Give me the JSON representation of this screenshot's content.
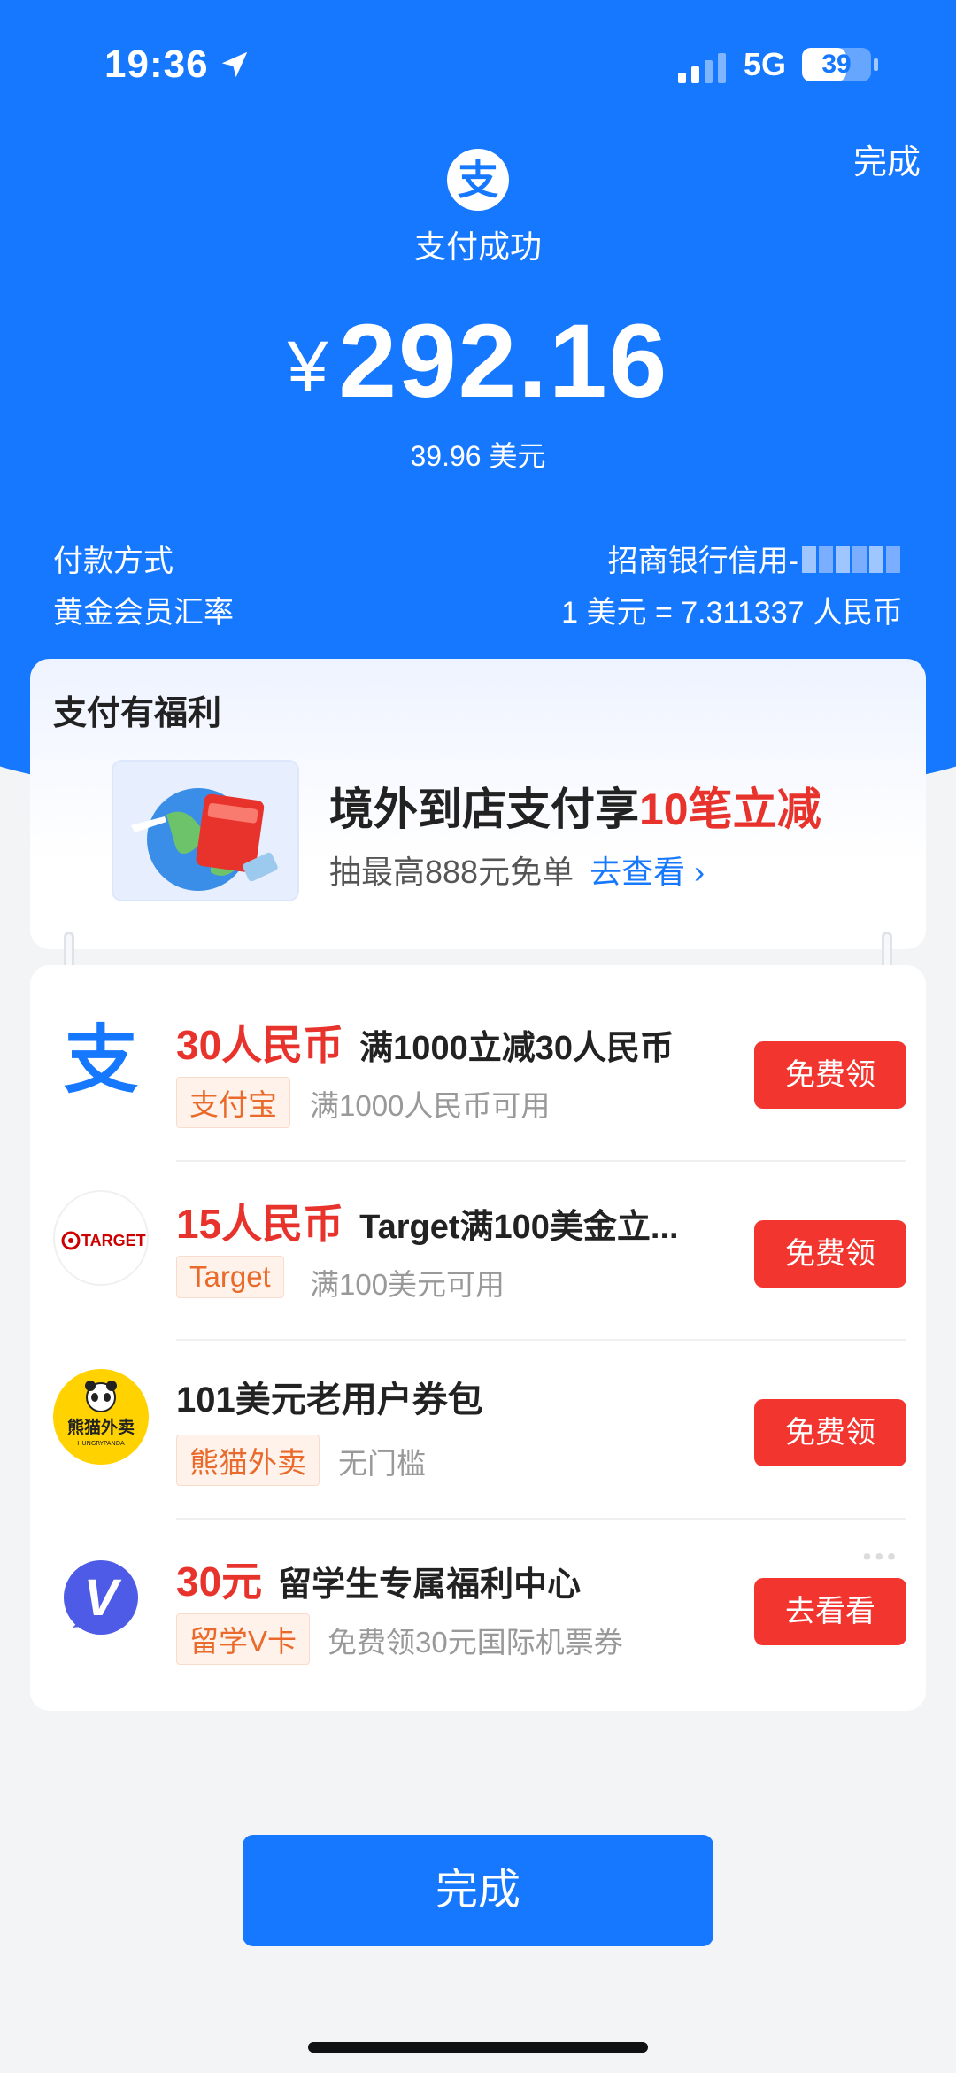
{
  "status_bar": {
    "time": "19:36",
    "network": "5G",
    "battery": "39"
  },
  "header": {
    "done_label": "完成",
    "success_text": "支付成功",
    "currency_symbol": "¥",
    "amount": "292.16",
    "original_amount": "39.96 美元",
    "app_logo_char": "支"
  },
  "details": [
    {
      "label": "付款方式",
      "value": "招商银行信用-"
    },
    {
      "label": "黄金会员汇率",
      "value": "1 美元 = 7.311337 人民币"
    }
  ],
  "benefits": {
    "title": "支付有福利",
    "promo_title_main": "境外到店支付享",
    "promo_title_highlight": "10笔立减",
    "promo_sub": "抽最高888元免单",
    "promo_link": "去查看 ›"
  },
  "coupons": [
    {
      "logo": "alipay-icon",
      "amount": "30人民币",
      "desc": "满1000立减30人民币",
      "tag": "支付宝",
      "note": "满1000人民币可用",
      "button": "免费领"
    },
    {
      "logo": "target-icon",
      "amount": "15人民币",
      "desc": "Target满100美金立...",
      "tag": "Target",
      "note": "满100美元可用",
      "button": "免费领"
    },
    {
      "logo": "hungrypanda-icon",
      "amount": "",
      "desc": "101美元老用户券包",
      "tag": "熊猫外卖",
      "note": "无门槛",
      "button": "免费领"
    },
    {
      "logo": "v-card-icon",
      "amount": "30元",
      "desc": "留学生专属福利中心",
      "tag": "留学V卡",
      "note": "免费领30元国际机票券",
      "button": "去看看"
    }
  ],
  "logo_texts": {
    "target": "TARGET",
    "panda": "熊猫外卖",
    "panda_sub": "HUNGRYPANDA",
    "vcard": "V"
  },
  "footer": {
    "done_label": "完成"
  },
  "colors": {
    "primary": "#1677ff",
    "accent_red": "#e8322c",
    "button_red": "#f2362f"
  }
}
